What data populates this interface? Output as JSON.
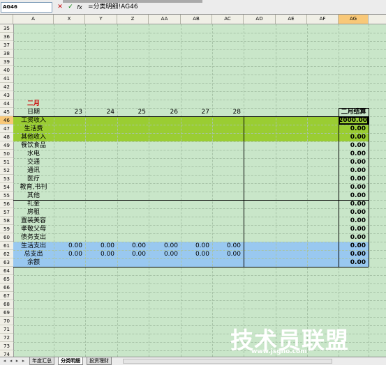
{
  "formula_bar": {
    "name_box": "AG46",
    "cancel_symbol": "✕",
    "enter_symbol": "✓",
    "function_symbol": "fx",
    "formula": "=分类明细!AG46"
  },
  "columns": [
    {
      "label": "A",
      "selected": false
    },
    {
      "label": "X",
      "selected": false
    },
    {
      "label": "Y",
      "selected": false
    },
    {
      "label": "Z",
      "selected": false
    },
    {
      "label": "AA",
      "selected": false
    },
    {
      "label": "AB",
      "selected": false
    },
    {
      "label": "AC",
      "selected": false
    },
    {
      "label": "AD",
      "selected": false
    },
    {
      "label": "AE",
      "selected": false
    },
    {
      "label": "AF",
      "selected": false
    },
    {
      "label": "AG",
      "selected": true
    }
  ],
  "rows": [
    "35",
    "36",
    "37",
    "38",
    "39",
    "40",
    "41",
    "42",
    "43",
    "44",
    "45",
    "46",
    "47",
    "48",
    "49",
    "50",
    "51",
    "52",
    "53",
    "54",
    "55",
    "56",
    "57",
    "58",
    "59",
    "60",
    "61",
    "62",
    "63",
    "64",
    "65",
    "66",
    "67",
    "68",
    "69",
    "70",
    "71",
    "72",
    "73",
    "74"
  ],
  "selected_row": "46",
  "sheet": {
    "month_title": "二月",
    "date_label": "日期",
    "dates": [
      "23",
      "24",
      "25",
      "26",
      "27",
      "28"
    ],
    "summary_header": "二月结算",
    "category_labels": [
      "工资收入",
      "生活费",
      "其他收入",
      "餐饮食品",
      "水电",
      "交通",
      "通讯",
      "医疗",
      "教育,书刊",
      "其他",
      "礼金",
      "房租",
      "置装美容",
      "孝敬父母",
      "债务支出",
      "生活支出",
      "总支出",
      "余额"
    ],
    "summary_values": [
      "2000.00",
      "0.00",
      "0.00",
      "0.00",
      "0.00",
      "0.00",
      "0.00",
      "0.00",
      "0.00",
      "0.00",
      "0.00",
      "0.00",
      "0.00",
      "0.00",
      "0.00",
      "0.00",
      "0.00",
      "0.00"
    ],
    "living_expense_values": [
      "0.00",
      "0.00",
      "0.00",
      "0.00",
      "0.00",
      "0.00"
    ],
    "total_expense_values": [
      "0.00",
      "0.00",
      "0.00",
      "0.00",
      "0.00",
      "0.00"
    ]
  },
  "tabs": {
    "nav": [
      "◂",
      "◂",
      "▸",
      "▸"
    ],
    "items": [
      {
        "label": "年度汇总",
        "active": false
      },
      {
        "label": "分类明细",
        "active": true
      },
      {
        "label": "投资理财",
        "active": false
      }
    ]
  },
  "watermark": {
    "text": "技术员联盟",
    "url": "www.jsgho.com"
  },
  "colors": {
    "sheet_bg": "#c9e6c9",
    "income_band": "#9acd32",
    "expense_band": "#99c8f0",
    "header_selected": "#f8c878",
    "title_red": "#cc0000"
  }
}
